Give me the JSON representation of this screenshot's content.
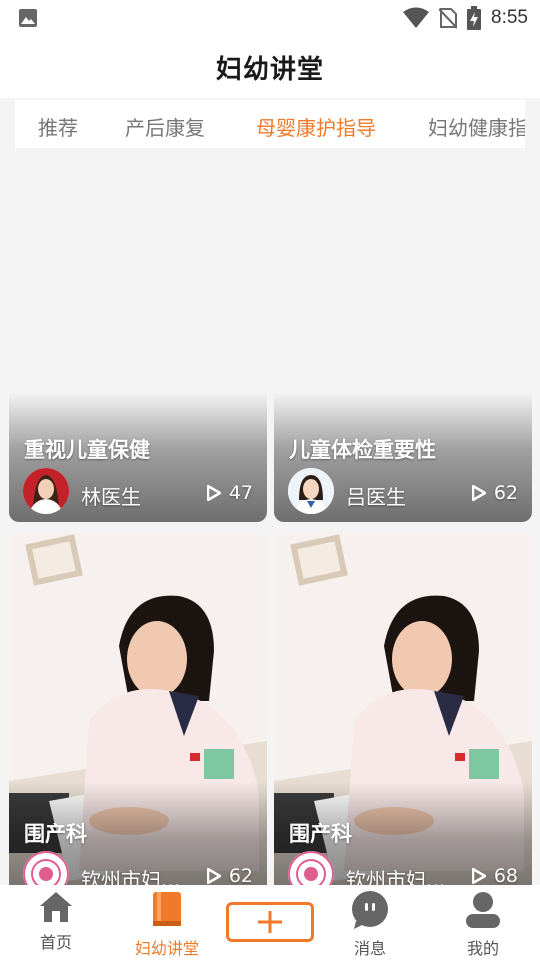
{
  "status_bar": {
    "time": "8:55"
  },
  "header": {
    "title": "妇幼讲堂"
  },
  "tabs": [
    {
      "label": "推荐"
    },
    {
      "label": "产后康复"
    },
    {
      "label": "母婴康护指导"
    },
    {
      "label": "妇幼健康指"
    }
  ],
  "active_tab": "母婴康护指导",
  "cards": [
    {
      "title": "重视儿童保健",
      "author": "林医生",
      "views": "47"
    },
    {
      "title": "儿童体检重要性",
      "author": "吕医生",
      "views": "62"
    },
    {
      "title": "围产科",
      "author": "钦州市妇...",
      "views": "62"
    },
    {
      "title": "围产科",
      "author": "钦州市妇...",
      "views": "68"
    }
  ],
  "bottom_nav": [
    {
      "label": "首页",
      "icon": "home-icon"
    },
    {
      "label": "妇幼讲堂",
      "icon": "book-icon"
    },
    {
      "label": "",
      "icon": "plus-icon"
    },
    {
      "label": "消息",
      "icon": "chat-icon"
    },
    {
      "label": "我的",
      "icon": "person-icon"
    }
  ],
  "colors": {
    "accent": "#f07a2a",
    "inactive": "#777777",
    "background": "#f4f4f4"
  }
}
